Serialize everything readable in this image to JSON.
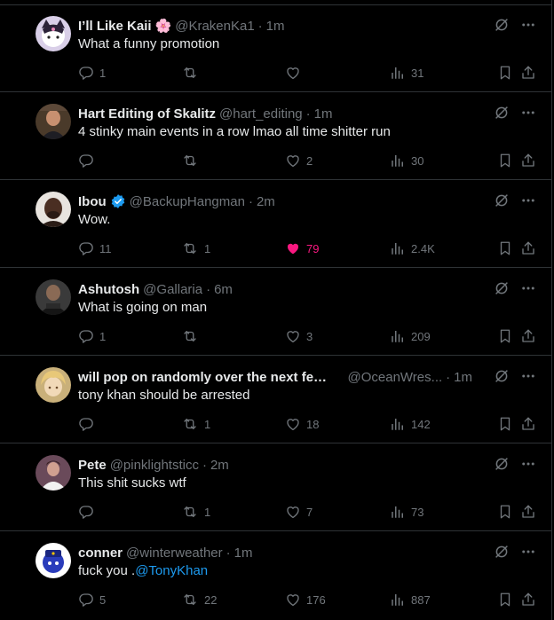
{
  "posts": [
    {
      "name": "I’ll Like Kaii",
      "emoji": "🌸",
      "handle": "@KrakenKa1",
      "time": "1m",
      "text": "What a funny promotion",
      "mention": "",
      "replies": "1",
      "reposts": "",
      "likes": "",
      "views": "31",
      "liked": false,
      "verified": false
    },
    {
      "name": "Hart Editing of Skalitz",
      "emoji": "",
      "handle": "@hart_editing",
      "time": "1m",
      "text": "4 stinky main events in a row lmao all time shitter run",
      "mention": "",
      "replies": "",
      "reposts": "",
      "likes": "2",
      "views": "30",
      "liked": false,
      "verified": false
    },
    {
      "name": "Ibou",
      "emoji": "",
      "handle": "@BackupHangman",
      "time": "2m",
      "text": "Wow.",
      "mention": "",
      "replies": "11",
      "reposts": "1",
      "likes": "79",
      "views": "2.4K",
      "liked": true,
      "verified": true
    },
    {
      "name": "Ashutosh",
      "emoji": "",
      "handle": "@Gallaria",
      "time": "6m",
      "text": "What is going on man",
      "mention": "",
      "replies": "1",
      "reposts": "",
      "likes": "3",
      "views": "209",
      "liked": false,
      "verified": false
    },
    {
      "name": "will pop on randomly over the next few mo...",
      "emoji": "",
      "handle": "@OceanWres...",
      "time": "1m",
      "text": "tony khan should be arrested",
      "mention": "",
      "replies": "",
      "reposts": "1",
      "likes": "18",
      "views": "142",
      "liked": false,
      "verified": false
    },
    {
      "name": "Pete",
      "emoji": "",
      "handle": "@pinklightsticc",
      "time": "2m",
      "text": "This shit sucks wtf",
      "mention": "",
      "replies": "",
      "reposts": "1",
      "likes": "7",
      "views": "73",
      "liked": false,
      "verified": false
    },
    {
      "name": "conner",
      "emoji": "",
      "handle": "@winterweather",
      "time": "1m",
      "text": "fuck you .",
      "mention": "@TonyKhan",
      "replies": "5",
      "reposts": "22",
      "likes": "176",
      "views": "887",
      "liked": false,
      "verified": false
    }
  ],
  "meta": {
    "separator": "·"
  },
  "icons": {
    "grok": "grok-icon",
    "more": "more-icon",
    "reply": "reply-icon",
    "repost": "repost-icon",
    "like": "heart-icon",
    "views": "views-icon",
    "bookmark": "bookmark-icon",
    "share": "share-icon",
    "verified": "verified-badge-icon"
  },
  "colors": {
    "background": "#000000",
    "text": "#e7e9ea",
    "muted": "#71767b",
    "accent": "#1d9bf0",
    "like": "#f91880",
    "border": "#2f3336"
  }
}
